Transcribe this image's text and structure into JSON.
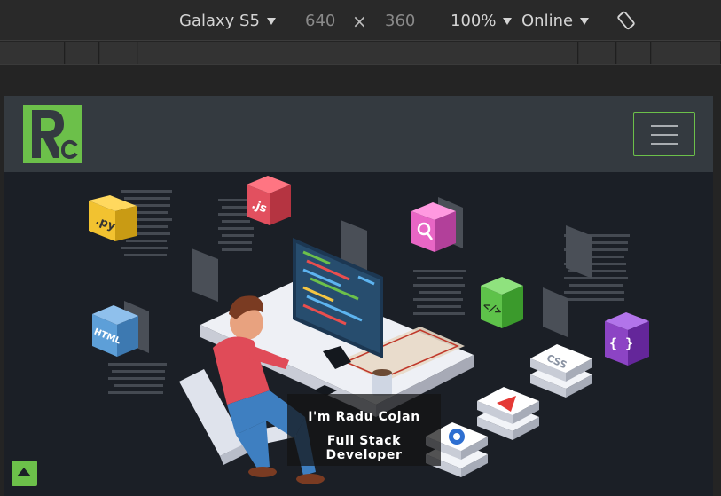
{
  "devtools": {
    "device": "Galaxy S5",
    "width": "640",
    "times": "×",
    "height": "360",
    "zoom": "100%",
    "network": "Online",
    "icons": [
      "caret-down-icon",
      "rotate-icon"
    ]
  },
  "navbar": {
    "logo_text": "Rc",
    "toggler_icon": "hamburger-icon",
    "accent_color": "#6cc04a"
  },
  "hero": {
    "tiles": [
      ".py",
      ".js",
      "HTML",
      "</>",
      "{ }",
      "CSS"
    ],
    "line1": "I'm Radu Cojan",
    "line2": "Full Stack Developer"
  },
  "scroll_top_icon": "arrow-up-icon"
}
